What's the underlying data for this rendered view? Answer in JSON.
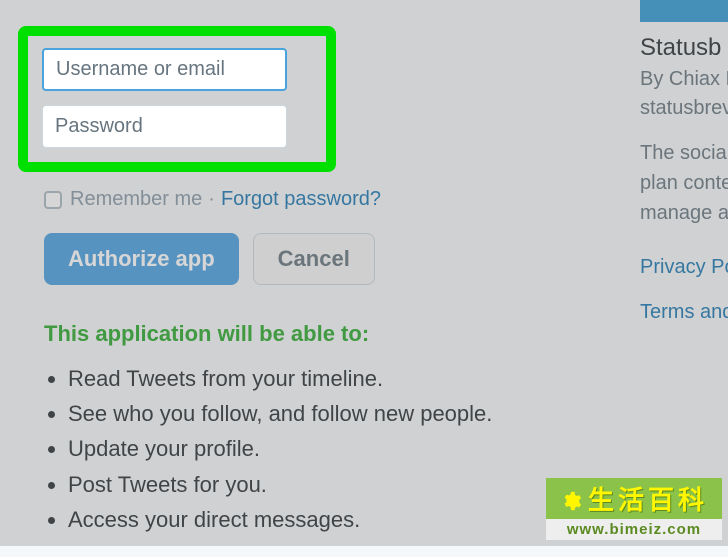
{
  "login": {
    "username_placeholder": "Username or email",
    "password_placeholder": "Password",
    "remember_label": "Remember me",
    "forgot_label": "Forgot password?",
    "separator": "·"
  },
  "buttons": {
    "authorize": "Authorize app",
    "cancel": "Cancel"
  },
  "permissions": {
    "title": "This application will be able to:",
    "items": [
      "Read Tweets from your timeline.",
      "See who you follow, and follow new people.",
      "Update your profile.",
      "Post Tweets for you.",
      "Access your direct messages."
    ]
  },
  "sidebar": {
    "title": "Statusb",
    "byline": "By Chiax L",
    "domain": "statusbrev",
    "desc_line1": "The social",
    "desc_line2": "plan conte",
    "desc_line3": "manage a",
    "privacy": "Privacy Po",
    "terms": "Terms and"
  },
  "watermark": {
    "top": "生活百科",
    "url": "www.bimeiz.com"
  }
}
